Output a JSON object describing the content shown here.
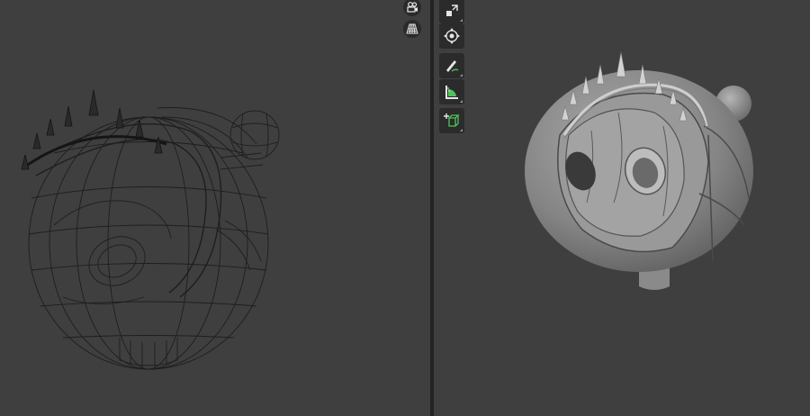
{
  "app": {
    "type": "3d-modeling-split-view"
  },
  "left_viewport": {
    "mode": "wireframe",
    "nav_icons": [
      "camera-icon",
      "grid-perspective-icon"
    ]
  },
  "right_viewport": {
    "mode": "solid",
    "toolbar": [
      "scale-icon",
      "transform-icon",
      "annotate-icon",
      "measure-icon",
      "add-cube-icon"
    ]
  },
  "colors": {
    "background": "#3f3f3f",
    "divider": "#232323",
    "tool_button": "#2b2b2b",
    "icon": "#e6e6e6",
    "accent_green": "#4fc45a",
    "accent_blue": "#4a90d9",
    "wire": "#1e1e1e",
    "solid_model": "#8a8a8a"
  }
}
